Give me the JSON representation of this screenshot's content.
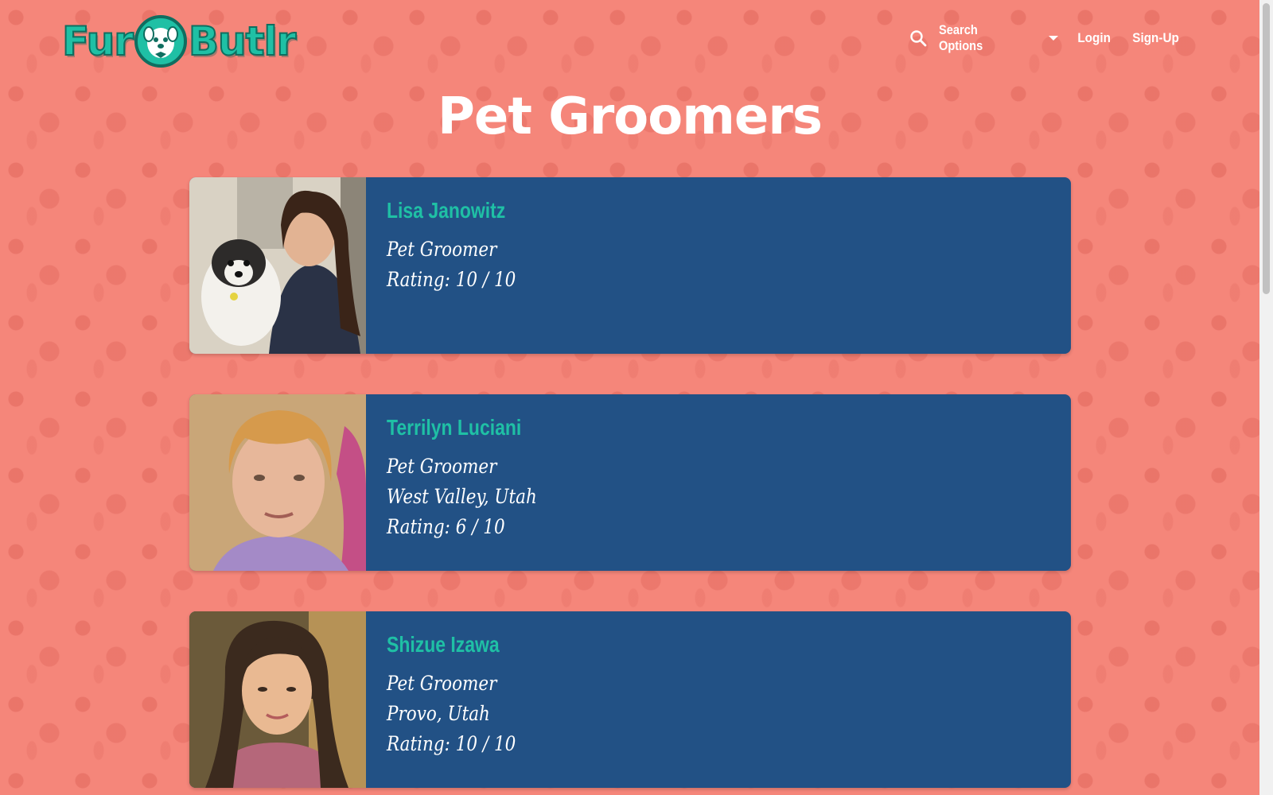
{
  "header": {
    "logo_left": "Fur",
    "logo_right": "Butlr",
    "search_options_label": "Search Options",
    "login_label": "Login",
    "signup_label": "Sign-Up"
  },
  "page": {
    "title": "Pet Groomers"
  },
  "groomers": [
    {
      "name": "Lisa Janowitz",
      "role": "Pet Groomer",
      "location": "",
      "rating": "Rating: 10 / 10"
    },
    {
      "name": "Terrilyn Luciani",
      "role": "Pet Groomer",
      "location": "West Valley, Utah",
      "rating": "Rating: 6 / 10"
    },
    {
      "name": "Shizue Izawa",
      "role": "Pet Groomer",
      "location": "Provo, Utah",
      "rating": "Rating: 10 / 10"
    }
  ],
  "icons": {
    "search": "search-icon",
    "dropdown": "chevron-down-icon",
    "logo_badge": "pet-face-icon"
  },
  "colors": {
    "background": "#f5867a",
    "card": "#225185",
    "accent": "#1fc0a5",
    "text": "#ffffff"
  }
}
